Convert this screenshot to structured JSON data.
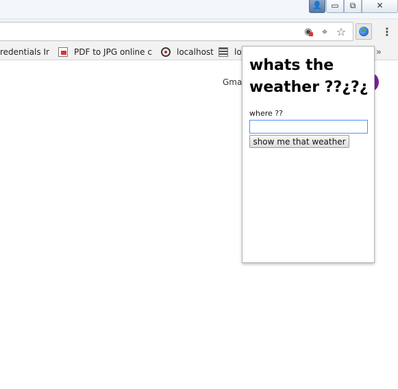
{
  "window": {
    "controls": {
      "user": "👤",
      "minimize": "▭",
      "restore": "⧉",
      "close": "✕"
    }
  },
  "toolbar": {
    "icons": [
      "blocked-location-icon",
      "location-target-icon",
      "bookmark-star-icon",
      "weather-extension-icon",
      "menu-icon"
    ],
    "location_glyph": "◉",
    "target_glyph": "⌖",
    "star_glyph": "☆",
    "menu_glyph": "⋮"
  },
  "bookmarks": {
    "items": [
      {
        "label": "redentials In U"
      },
      {
        "label": "PDF to JPG online co"
      },
      {
        "label": "localhost"
      },
      {
        "label": "lo"
      }
    ],
    "overflow_glyph": "»"
  },
  "page": {
    "gmail_link": "Gma"
  },
  "popup": {
    "title": "whats the weather ??¿?¿",
    "field_label": "where ??",
    "input_value": "",
    "button_label": "show me that weather"
  }
}
